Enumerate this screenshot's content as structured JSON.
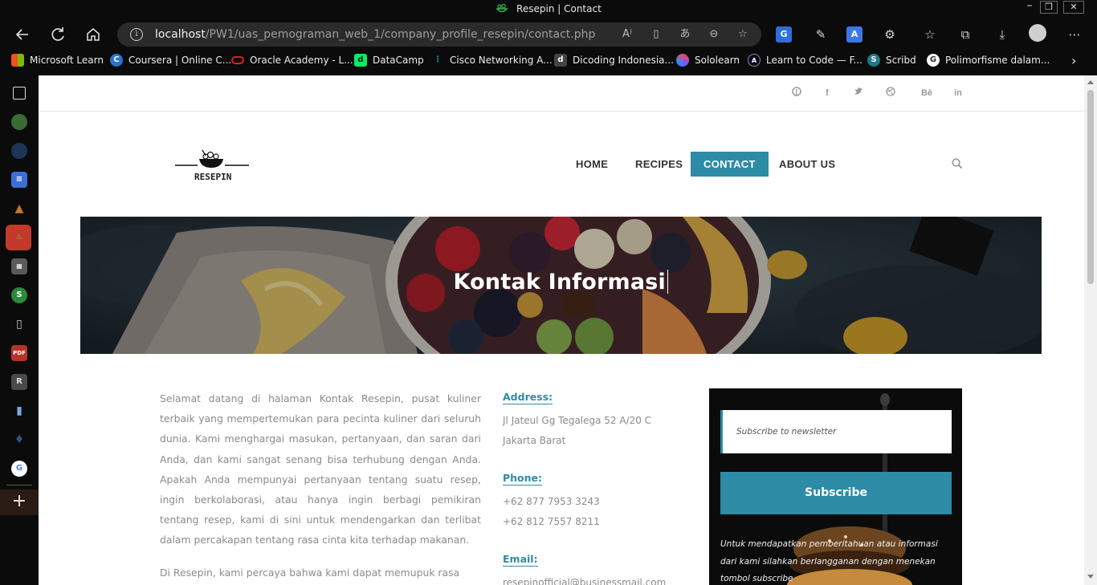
{
  "window": {
    "title": "Resepin | Contact",
    "controls": [
      "–",
      "❐",
      "✕"
    ]
  },
  "browser": {
    "url_host": "localhost",
    "url_path": "/PW1/uas_pemograman_web_1/company_profile_resepin/contact.php"
  },
  "bookmarks": [
    {
      "label": "Microsoft Learn",
      "icon": "microsoft-icon",
      "color": "#f25022"
    },
    {
      "label": "Coursera | Online C...",
      "icon": "coursera-icon",
      "color": "#2a73cc"
    },
    {
      "label": "Oracle Academy - L...",
      "icon": "oracle-icon",
      "color": "#e02020"
    },
    {
      "label": "DataCamp",
      "icon": "datacamp-icon",
      "color": "#03ef62"
    },
    {
      "label": "Cisco Networking A...",
      "icon": "cisco-icon",
      "color": "#1ba0d7"
    },
    {
      "label": "Dicoding Indonesia...",
      "icon": "dicoding-icon",
      "color": "#444444"
    },
    {
      "label": "Sololearn",
      "icon": "sololearn-icon",
      "color": "#8a4cf0"
    },
    {
      "label": "Learn to Code — F...",
      "icon": "freecodecamp-icon",
      "color": "#0a0a23"
    },
    {
      "label": "Scribd",
      "icon": "scribd-icon",
      "color": "#1e7b85"
    },
    {
      "label": "Polimorfisme dalam...",
      "icon": "google-icon",
      "color": "#ffffff"
    }
  ],
  "site": {
    "logo_text": "RESEPIN",
    "social": [
      "pinterest-icon",
      "facebook-icon",
      "twitter-icon",
      "dribbble-icon",
      "behance-icon",
      "linkedin-icon"
    ],
    "nav": {
      "home": "HOME",
      "recipes": "RECIPES",
      "contact": "CONTACT",
      "about": "ABOUT US"
    },
    "hero_title": "Kontak Informasi",
    "intro": [
      "Selamat datang di halaman Kontak Resepin, pusat kuliner terbaik yang mempertemukan para pecinta kuliner dari seluruh dunia. Kami menghargai masukan, pertanyaan, dan saran dari Anda, dan kami sangat senang bisa terhubung dengan Anda. Apakah Anda mempunyai pertanyaan tentang suatu resep, ingin berkolaborasi, atau hanya ingin berbagi pemikiran tentang resep, kami di sini untuk mendengarkan dan terlibat dalam percakapan tentang rasa cinta kita terhadap makanan.",
      "Di Resepin, kami percaya bahwa kami dapat memupuk rasa"
    ],
    "contact": {
      "address_label": "Address:",
      "address_line1": "Jl Jateul Gg Tegalega 52 A/20 C",
      "address_line2": "Jakarta Barat",
      "phone_label": "Phone:",
      "phone1": "+62 877 7953 3243",
      "phone2": "+62 812 7557 8211",
      "email_label": "Email:",
      "email": "resepinofficial@businessmail.com"
    },
    "newsletter": {
      "placeholder": "Subscribe to newsletter",
      "button": "Subscribe",
      "note": "Untuk mendapatkan pemberitahuan atau informasi dari kami silahkan berlangganan dengan menekan tombol subscribe"
    }
  },
  "colors": {
    "accent": "#2e8ba6",
    "body_text": "#8b8b8b",
    "chrome_bg": "#0b0b0b"
  }
}
